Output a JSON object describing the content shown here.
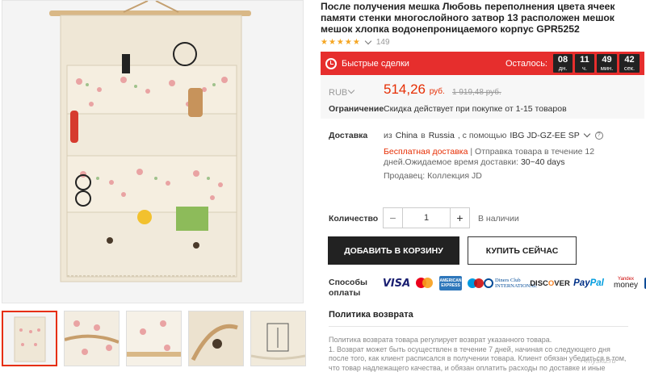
{
  "product": {
    "title": "После получения мешка Любовь переполнения цвета ячеек памяти стенки многослойного затвор 13 расположен мешок мешок хлопка водонепроницаемого корпус GPR5252",
    "stars": "★★★★★",
    "review_count": "149"
  },
  "flash_deal": {
    "label": "Быстрые сделки",
    "remaining_label": "Осталось:",
    "countdown": [
      {
        "value": "08",
        "unit": "дн."
      },
      {
        "value": "11",
        "unit": "ч."
      },
      {
        "value": "49",
        "unit": "мин."
      },
      {
        "value": "42",
        "unit": "сек."
      }
    ],
    "bg_color": "#e62e2d"
  },
  "price": {
    "currency": "RUB",
    "current": "514,26",
    "current_unit": "руб.",
    "old": "1 919,48 руб.",
    "limit_label": "Ограничение",
    "limit_text": "Скидка действует при покупке от 1-15 товаров",
    "accent_color": "#e62e04"
  },
  "shipping": {
    "label": "Доставка",
    "from_word": "из",
    "from": "China",
    "to_word": "в",
    "to": "Russia",
    "via_word": ", с помощью",
    "method": "IBG JD-GZ-EE SP",
    "free": "Бесплатная доставка",
    "separator": "|",
    "ship_time_text": "Отправка товара в течение 12 дней.Ожидаемое время доставки:",
    "delivery_days": "30~40 days",
    "seller_label": "Продавец:",
    "seller": "Коллекция JD"
  },
  "quantity": {
    "label": "Количество",
    "minus": "−",
    "value": "1",
    "plus": "+",
    "stock": "В наличии"
  },
  "buttons": {
    "add_to_cart": "ДОБАВИТЬ В КОРЗИНУ",
    "buy_now": "КУПИТЬ СЕЙЧАС"
  },
  "payment": {
    "label_line1": "Способы",
    "label_line2": "оплаты",
    "methods": [
      "VISA",
      "MasterCard",
      "American Express",
      "Maestro",
      "Diners Club International",
      "DISCOVER",
      "PayPal",
      "Yandex money",
      "JCB"
    ],
    "visa": "VISA",
    "amex": "AMERICAN EXPRESS",
    "diners": "Diners Club INTERNATIONAL",
    "discover_a": "DISC",
    "discover_b": "O",
    "discover_c": "VER",
    "paypal_a": "Pay",
    "paypal_b": "Pal",
    "yandex_a": "Yandex",
    "yandex_b": "money"
  },
  "policy": {
    "title": "Политика возврата",
    "line1": "Политика возврата товара регулирует возврат указанного товара.",
    "line2": "1. Возврат может быть осуществлен в течение 7 дней, начиная со следующего дня после того, как клиент расписался в получении товара. Клиент обязан убедиться в том, что товар надлежащего качества, и обязан оплатить расходы по доставке и иные расходы:"
  },
  "watermark": "mysku.ru"
}
